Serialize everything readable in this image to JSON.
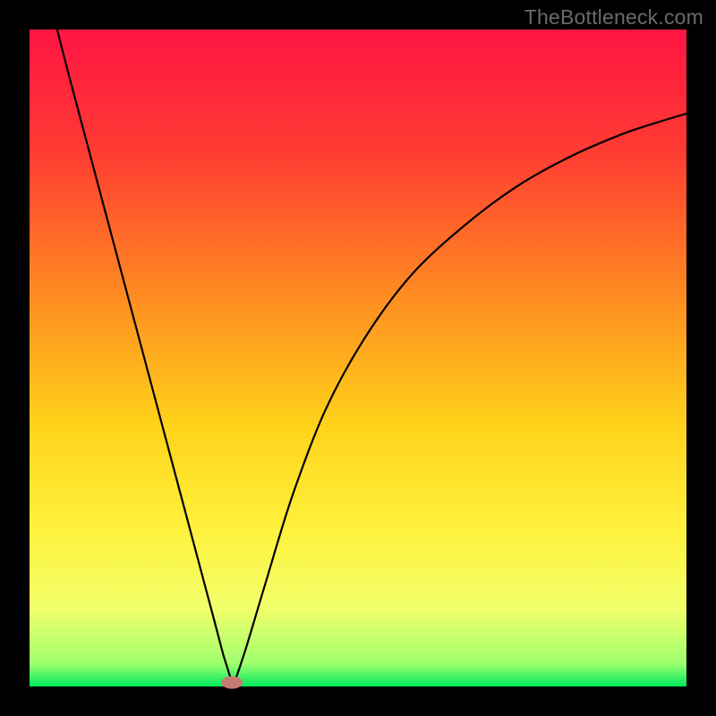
{
  "watermark": "TheBottleneck.com",
  "chart_data": {
    "type": "line",
    "title": "",
    "xlabel": "",
    "ylabel": "",
    "x_range": [
      0,
      1
    ],
    "y_range": [
      0,
      1
    ],
    "gradient_stops": [
      {
        "offset": 0.0,
        "color": "#ff1543"
      },
      {
        "offset": 0.18,
        "color": "#ff3a33"
      },
      {
        "offset": 0.4,
        "color": "#ff8a22"
      },
      {
        "offset": 0.6,
        "color": "#ffd21a"
      },
      {
        "offset": 0.76,
        "color": "#fff13c"
      },
      {
        "offset": 0.88,
        "color": "#f2ff6a"
      },
      {
        "offset": 0.965,
        "color": "#a0ff6e"
      },
      {
        "offset": 1.0,
        "color": "#00e95e"
      }
    ],
    "series": [
      {
        "name": "left-branch",
        "x": [
          0.042,
          0.06,
          0.08,
          0.1,
          0.12,
          0.14,
          0.16,
          0.18,
          0.2,
          0.22,
          0.24,
          0.26,
          0.28,
          0.295,
          0.31
        ],
        "y": [
          1.0,
          0.93,
          0.855,
          0.78,
          0.705,
          0.63,
          0.555,
          0.48,
          0.405,
          0.33,
          0.255,
          0.18,
          0.105,
          0.048,
          0.0
        ]
      },
      {
        "name": "right-branch",
        "x": [
          0.31,
          0.33,
          0.36,
          0.4,
          0.45,
          0.51,
          0.58,
          0.66,
          0.74,
          0.82,
          0.9,
          0.96,
          1.0
        ],
        "y": [
          0.0,
          0.06,
          0.16,
          0.29,
          0.42,
          0.53,
          0.625,
          0.7,
          0.76,
          0.805,
          0.84,
          0.86,
          0.872
        ]
      }
    ],
    "marker": {
      "x": 0.308,
      "y": 0.006,
      "color": "#c77a72"
    }
  }
}
